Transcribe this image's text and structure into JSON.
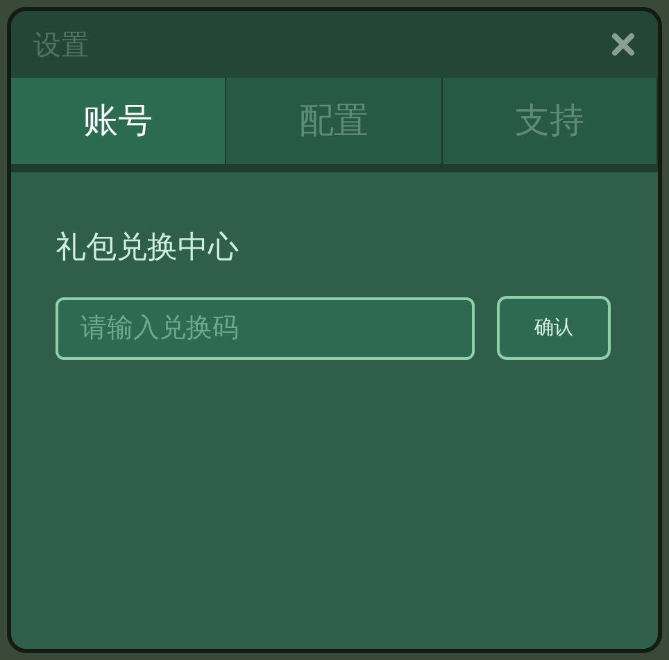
{
  "window": {
    "title": "设置"
  },
  "tabs": [
    {
      "label": "账号",
      "selected": true
    },
    {
      "label": "配置",
      "selected": false
    },
    {
      "label": "支持",
      "selected": false
    }
  ],
  "gift_section": {
    "title": "礼包兑换中心",
    "code_field": {
      "placeholder": "请输入兑换码"
    },
    "confirm_button": "确认"
  }
}
